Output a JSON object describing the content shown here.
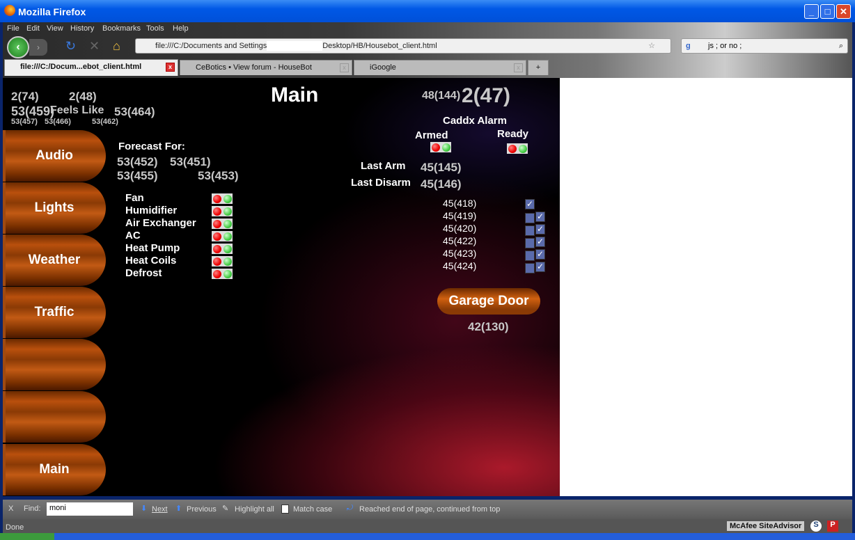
{
  "window": {
    "title": "Mozilla Firefox",
    "minimize": "_",
    "maximize": "□",
    "close": "✕"
  },
  "menu": [
    "File",
    "Edit",
    "View",
    "History",
    "Bookmarks",
    "Tools",
    "Help"
  ],
  "nav": {
    "url": "file:///C:/Documents and Settings",
    "url_tail": "Desktop/HB/Housebot_client.html",
    "search_value": "js ; or no ;"
  },
  "tabs": [
    {
      "label": "file:///C:/Docum...ebot_client.html",
      "active": true
    },
    {
      "label": "CeBotics • View forum - HouseBot"
    },
    {
      "label": "iGoogle"
    }
  ],
  "page": {
    "title": "Main",
    "weather": {
      "a": "2(74)",
      "b": "2(48)",
      "c": "53(459)",
      "feels_like": "Feels Like",
      "d": "53(464)",
      "e": "53(457)",
      "f": "53(466)",
      "g": "53(462)"
    },
    "forecast": {
      "label": "Forecast For:",
      "v1": "53(452)",
      "v2": "53(451)",
      "v3": "53(455)",
      "v4": "53(453)"
    },
    "hvac": [
      "Fan",
      "Humidifier",
      "Air Exchanger",
      "AC",
      "Heat Pump",
      "Heat Coils",
      "Defrost"
    ],
    "top_right": {
      "small": "48(144)",
      "big": "2(47)"
    },
    "alarm": {
      "title": "Caddx Alarm",
      "armed": "Armed",
      "ready": "Ready",
      "last_arm_label": "Last Arm",
      "last_arm": "45(145)",
      "last_disarm_label": "Last Disarm",
      "last_disarm": "45(146)"
    },
    "zones": [
      {
        "label": "45(418)",
        "boxes": 1
      },
      {
        "label": "45(419)",
        "boxes": 2
      },
      {
        "label": "45(420)",
        "boxes": 2
      },
      {
        "label": "45(422)",
        "boxes": 2
      },
      {
        "label": "45(423)",
        "boxes": 2
      },
      {
        "label": "45(424)",
        "boxes": 2
      }
    ],
    "garage": {
      "label": "Garage Door",
      "status": "42(130)"
    },
    "sidebar": [
      "Audio",
      "Lights",
      "Weather",
      "Traffic",
      "",
      "",
      "Main"
    ]
  },
  "findbar": {
    "close": "X",
    "label": "Find:",
    "value": "moni",
    "next": "Next",
    "previous": "Previous",
    "highlight": "Highlight all",
    "match_case": "Match case",
    "message": "Reached end of page, continued from top"
  },
  "status": {
    "text": "Done",
    "siteadvisor": "McAfee SiteAdvisor"
  }
}
